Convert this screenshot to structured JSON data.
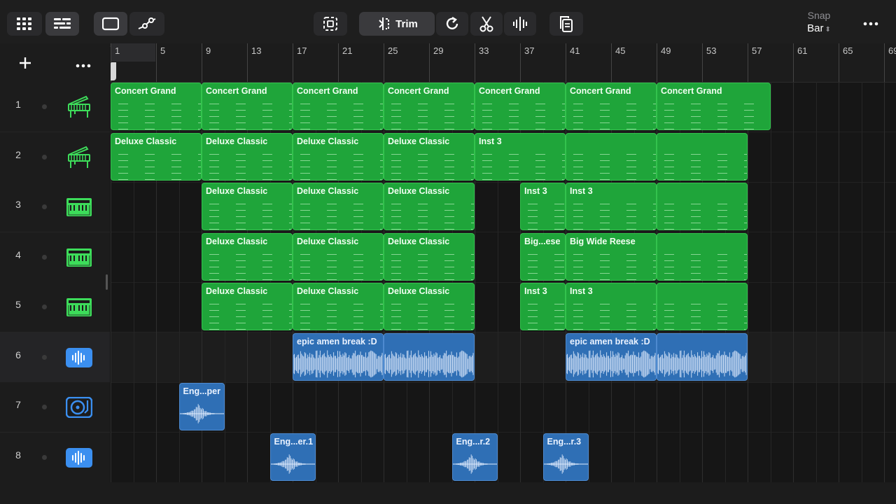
{
  "toolbar": {
    "trim_label": "Trim",
    "snap_label": "Snap",
    "snap_value": "Bar"
  },
  "ruler": {
    "bars": [
      "1",
      "5",
      "9",
      "13",
      "17",
      "21",
      "25",
      "29",
      "33",
      "37",
      "41",
      "45",
      "49",
      "53",
      "57",
      "61",
      "65",
      "69"
    ]
  },
  "tracks": [
    {
      "num": "1",
      "icon": "grand-piano-icon",
      "color": "#3ddc5a"
    },
    {
      "num": "2",
      "icon": "grand-piano-icon",
      "color": "#3ddc5a"
    },
    {
      "num": "3",
      "icon": "synth-keyboard-icon",
      "color": "#3ddc5a"
    },
    {
      "num": "4",
      "icon": "synth-keyboard-icon",
      "color": "#3ddc5a"
    },
    {
      "num": "5",
      "icon": "synth-keyboard-icon",
      "color": "#3ddc5a"
    },
    {
      "num": "6",
      "icon": "audio-waveform-icon",
      "color": "#3b8ff0"
    },
    {
      "num": "7",
      "icon": "turntable-icon",
      "color": "#3b8ff0"
    },
    {
      "num": "8",
      "icon": "audio-waveform-icon",
      "color": "#3b8ff0"
    }
  ],
  "clips": [
    {
      "track": 1,
      "start": 1,
      "len": 8,
      "name": "Concert Grand",
      "type": "midi"
    },
    {
      "track": 1,
      "start": 9,
      "len": 8,
      "name": "Concert Grand",
      "type": "midi"
    },
    {
      "track": 1,
      "start": 17,
      "len": 8,
      "name": "Concert Grand",
      "type": "midi"
    },
    {
      "track": 1,
      "start": 25,
      "len": 8,
      "name": "Concert Grand",
      "type": "midi"
    },
    {
      "track": 1,
      "start": 33,
      "len": 8,
      "name": "Concert Grand",
      "type": "midi"
    },
    {
      "track": 1,
      "start": 41,
      "len": 8,
      "name": "Concert Grand",
      "type": "midi"
    },
    {
      "track": 1,
      "start": 49,
      "len": 10,
      "name": "Concert Grand",
      "type": "midi"
    },
    {
      "track": 2,
      "start": 1,
      "len": 8,
      "name": "Deluxe Classic",
      "type": "midi"
    },
    {
      "track": 2,
      "start": 9,
      "len": 8,
      "name": "Deluxe Classic",
      "type": "midi"
    },
    {
      "track": 2,
      "start": 17,
      "len": 8,
      "name": "Deluxe Classic",
      "type": "midi"
    },
    {
      "track": 2,
      "start": 25,
      "len": 8,
      "name": "Deluxe Classic",
      "type": "midi"
    },
    {
      "track": 2,
      "start": 33,
      "len": 8,
      "name": "Inst 3",
      "type": "midi"
    },
    {
      "track": 2,
      "start": 41,
      "len": 8,
      "name": "",
      "type": "midi"
    },
    {
      "track": 2,
      "start": 49,
      "len": 8,
      "name": "",
      "type": "midi"
    },
    {
      "track": 3,
      "start": 9,
      "len": 8,
      "name": "Deluxe Classic",
      "type": "midi"
    },
    {
      "track": 3,
      "start": 17,
      "len": 8,
      "name": "Deluxe Classic",
      "type": "midi"
    },
    {
      "track": 3,
      "start": 25,
      "len": 8,
      "name": "Deluxe Classic",
      "type": "midi"
    },
    {
      "track": 3,
      "start": 37,
      "len": 4,
      "name": "Inst 3",
      "type": "midi"
    },
    {
      "track": 3,
      "start": 41,
      "len": 8,
      "name": "Inst 3",
      "type": "midi"
    },
    {
      "track": 3,
      "start": 49,
      "len": 8,
      "name": "",
      "type": "midi"
    },
    {
      "track": 4,
      "start": 9,
      "len": 8,
      "name": "Deluxe Classic",
      "type": "midi"
    },
    {
      "track": 4,
      "start": 17,
      "len": 8,
      "name": "Deluxe Classic",
      "type": "midi"
    },
    {
      "track": 4,
      "start": 25,
      "len": 8,
      "name": "Deluxe Classic",
      "type": "midi"
    },
    {
      "track": 4,
      "start": 37,
      "len": 4,
      "name": "Big...ese",
      "type": "midi"
    },
    {
      "track": 4,
      "start": 41,
      "len": 8,
      "name": "Big Wide Reese",
      "type": "midi"
    },
    {
      "track": 4,
      "start": 49,
      "len": 8,
      "name": "",
      "type": "midi"
    },
    {
      "track": 5,
      "start": 9,
      "len": 8,
      "name": "Deluxe Classic",
      "type": "midi"
    },
    {
      "track": 5,
      "start": 17,
      "len": 8,
      "name": "Deluxe Classic",
      "type": "midi"
    },
    {
      "track": 5,
      "start": 25,
      "len": 8,
      "name": "Deluxe Classic",
      "type": "midi"
    },
    {
      "track": 5,
      "start": 37,
      "len": 4,
      "name": "Inst 3",
      "type": "midi"
    },
    {
      "track": 5,
      "start": 41,
      "len": 8,
      "name": "Inst 3",
      "type": "midi"
    },
    {
      "track": 5,
      "start": 49,
      "len": 8,
      "name": "",
      "type": "midi"
    },
    {
      "track": 6,
      "start": 17,
      "len": 8,
      "name": "epic amen break :D",
      "type": "audio"
    },
    {
      "track": 6,
      "start": 25,
      "len": 8,
      "name": "",
      "type": "audio"
    },
    {
      "track": 6,
      "start": 41,
      "len": 8,
      "name": "epic amen break :D",
      "type": "audio"
    },
    {
      "track": 6,
      "start": 49,
      "len": 8,
      "name": "",
      "type": "audio"
    },
    {
      "track": 7,
      "start": 7,
      "len": 4,
      "name": "Eng...per",
      "type": "oneshot"
    },
    {
      "track": 8,
      "start": 15,
      "len": 4,
      "name": "Eng...er.1",
      "type": "oneshot"
    },
    {
      "track": 8,
      "start": 31,
      "len": 4,
      "name": "Eng...r.2",
      "type": "oneshot"
    },
    {
      "track": 8,
      "start": 39,
      "len": 4,
      "name": "Eng...r.3",
      "type": "oneshot"
    }
  ]
}
